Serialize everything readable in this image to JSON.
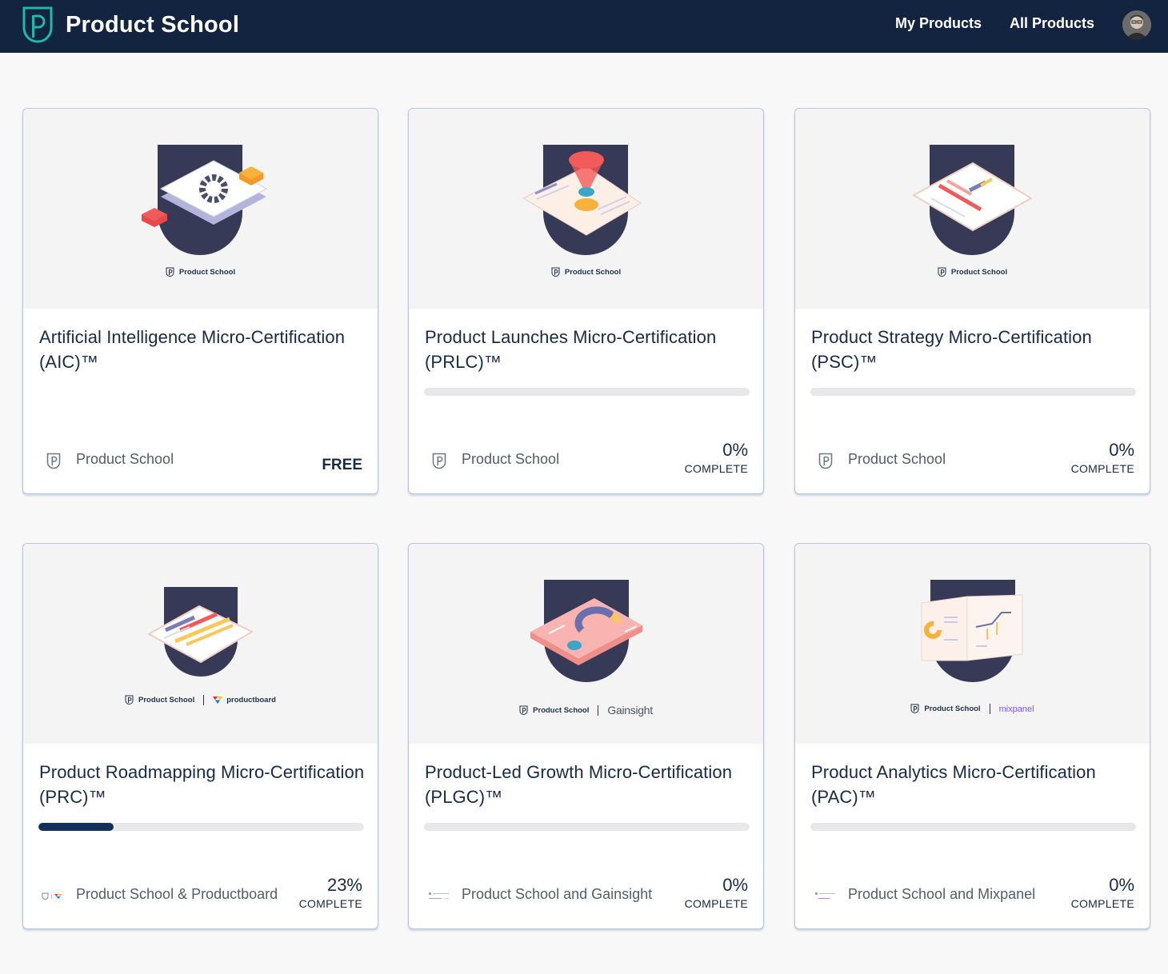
{
  "header": {
    "brand": "Product School",
    "nav": [
      {
        "label": "My Products"
      },
      {
        "label": "All Products"
      }
    ]
  },
  "colors": {
    "header_bg": "#12243f",
    "accent_teal": "#22b8a6",
    "progress_fill": "#12305a",
    "progress_track": "#e8e8ea",
    "shield_navy": "#373a57"
  },
  "cards": [
    {
      "title": "Artificial Intelligence Micro-Certification (AIC)™",
      "provider": "Product School",
      "media_brand": "Product School",
      "price": "FREE"
    },
    {
      "title": "Product Launches Micro-Certification (PRLC)™",
      "provider": "Product School",
      "media_brand": "Product School",
      "progress": 0,
      "progress_text": "0%",
      "progress_label": "COMPLETE"
    },
    {
      "title": "Product Strategy Micro-Certification (PSC)™",
      "provider": "Product School",
      "media_brand": "Product School",
      "progress": 0,
      "progress_text": "0%",
      "progress_label": "COMPLETE"
    },
    {
      "title": "Product Roadmapping Micro-Certification (PRC)™",
      "provider": "Product School & Productboard",
      "media_brand": "Product School",
      "partner": "productboard",
      "progress": 23,
      "progress_text": "23%",
      "progress_label": "COMPLETE"
    },
    {
      "title": "Product-Led Growth Micro-Certification (PLGC)™",
      "provider": "Product School and Gainsight",
      "media_brand": "Product School",
      "partner": "Gainsight",
      "progress": 0,
      "progress_text": "0%",
      "progress_label": "COMPLETE"
    },
    {
      "title": "Product Analytics Micro-Certification (PAC)™",
      "provider": "Product School and Mixpanel",
      "media_brand": "Product School",
      "partner": "mixpanel",
      "progress": 0,
      "progress_text": "0%",
      "progress_label": "COMPLETE"
    }
  ]
}
